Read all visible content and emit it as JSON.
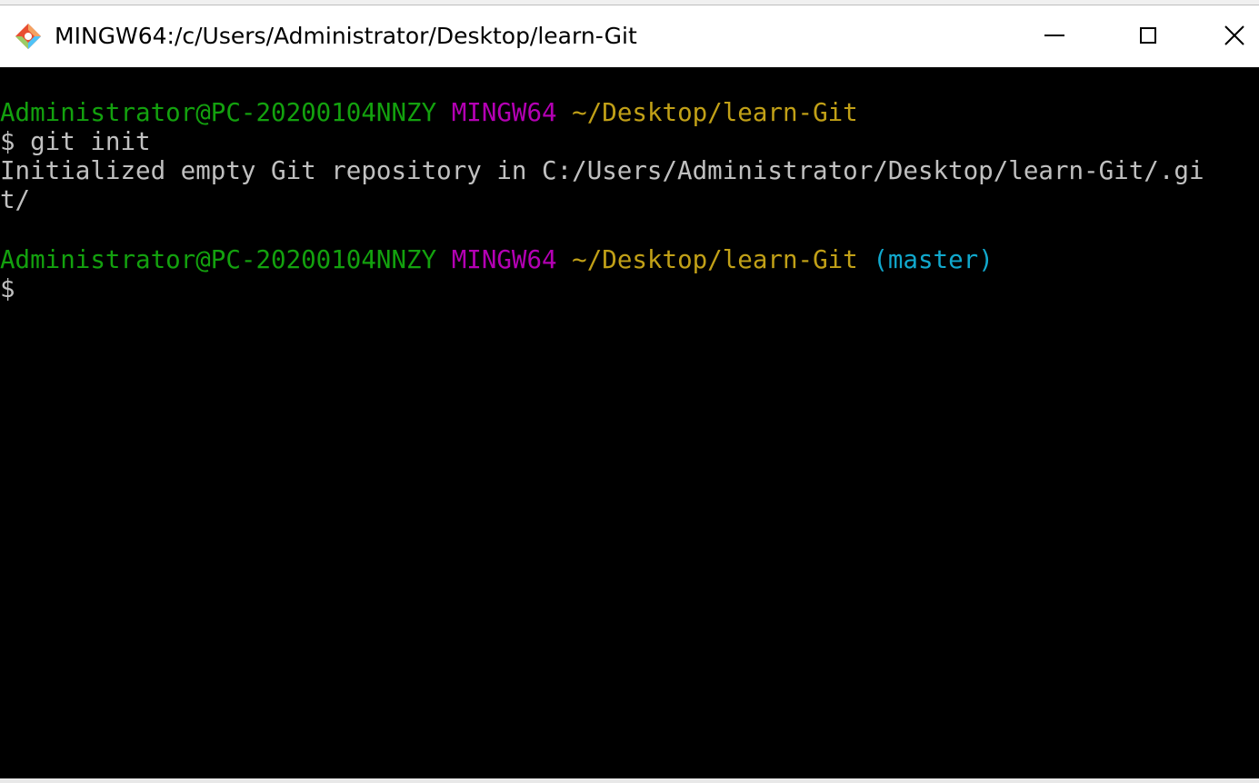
{
  "window": {
    "title": "MINGW64:/c/Users/Administrator/Desktop/learn-Git",
    "app_icon": "git-icon",
    "controls": {
      "minimize_icon": "minimize-icon",
      "maximize_icon": "maximize-icon",
      "close_icon": "close-icon",
      "close_glyph": "✕"
    }
  },
  "terminal": {
    "prompt1": {
      "user_host": "Administrator@PC-20200104NNZY",
      "env": "MINGW64",
      "path": "~/Desktop/learn-Git"
    },
    "command1": "$ git init",
    "output1_line1": "Initialized empty Git repository in C:/Users/Administrator/Desktop/learn-Git/.gi",
    "output1_line2": "t/",
    "prompt2": {
      "user_host": "Administrator@PC-20200104NNZY",
      "env": "MINGW64",
      "path": "~/Desktop/learn-Git",
      "branch": "(master)"
    },
    "command2": "$"
  },
  "colors": {
    "user_host": "#13a10e",
    "env": "#b400b4",
    "path": "#c1a017",
    "branch": "#11a8cd",
    "text": "#c0c0c0",
    "background": "#000000"
  }
}
